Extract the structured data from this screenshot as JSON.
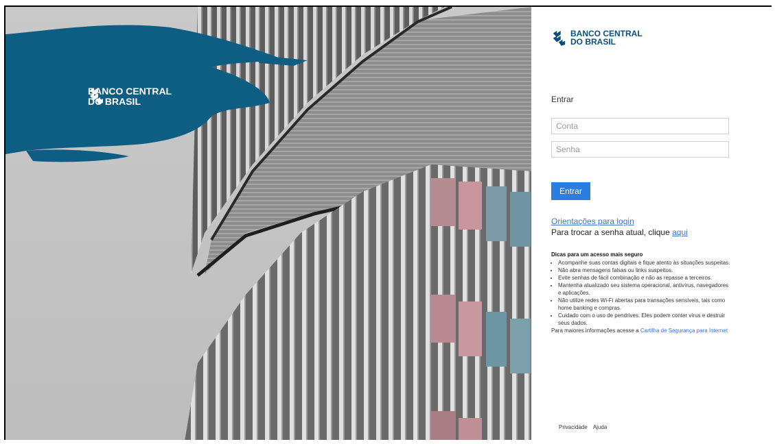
{
  "brand": {
    "line1": "BANCO CENTRAL",
    "line2": "DO BRASIL",
    "color": "#0b4f7a"
  },
  "login": {
    "title": "Entrar",
    "account_placeholder": "Conta",
    "password_placeholder": "Senha",
    "submit_label": "Entrar",
    "accent": "#2b7de2"
  },
  "links": {
    "guidance": "Orientações para login",
    "change_prefix": "Para trocar a senha atual, clique ",
    "change_link": "aqui"
  },
  "tips": {
    "heading": "Dicas para um acesso mais seguro",
    "items": [
      "Acompanhe suas contas digitais e fique atento às situações suspeitas.",
      "Não abra mensagens falsas ou links suspeitos.",
      "Evite senhas de fácil combinação e não as repasse a terceiros.",
      "Mantenha atualizado seu sistema operacional, antivírus, navegadores e aplicações.",
      "Não utilize redes Wi-Fi abertas para transações sensíveis, tais como home banking e compras.",
      "Cuidado com o uso de pendrives. Eles podem conter vírus e destruir seus dados."
    ],
    "more_prefix": "Para maiores informações acesse a ",
    "more_link": "Cartilha de Segurança para Internet"
  },
  "footer": {
    "privacy": "Privacidade",
    "help": "Ajuda"
  }
}
